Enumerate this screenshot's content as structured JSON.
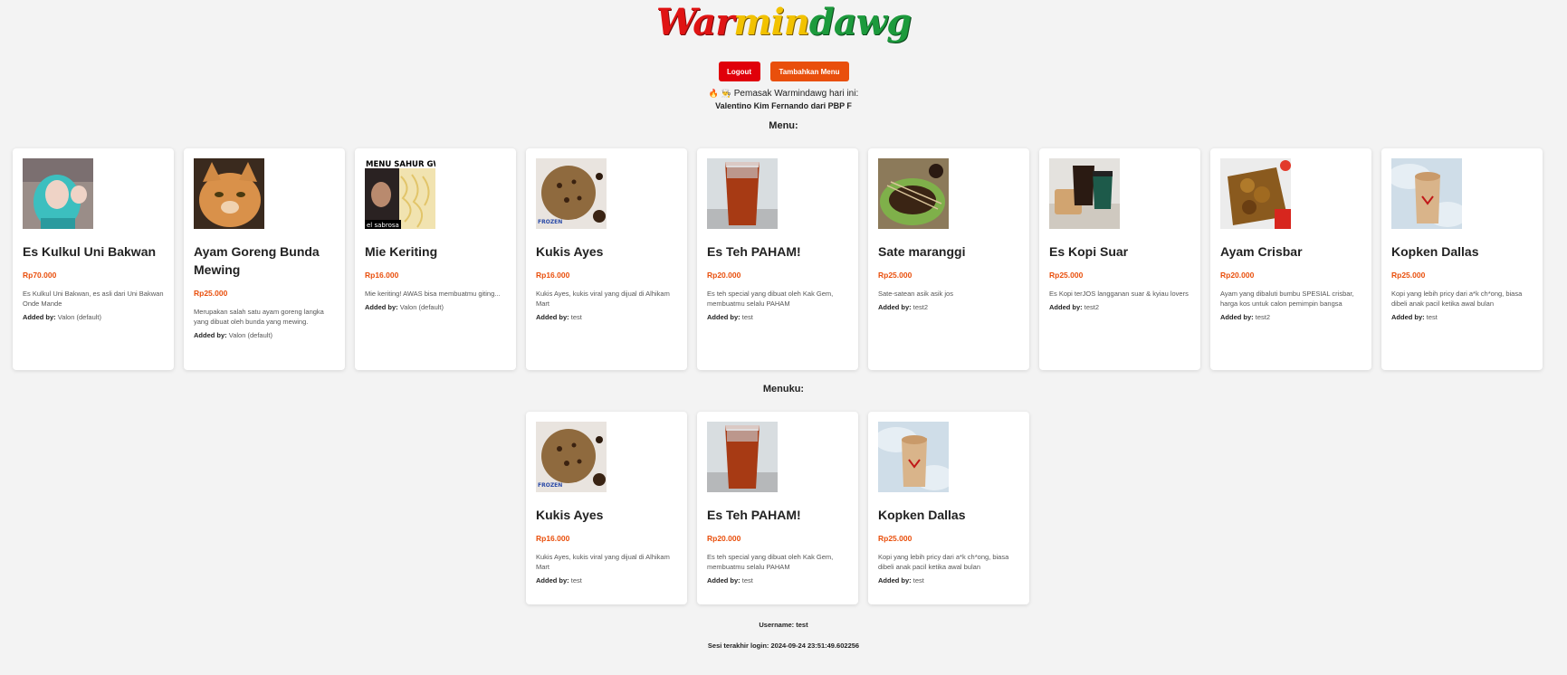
{
  "brand": {
    "part1": "War",
    "part2": "min",
    "part3": "dawg"
  },
  "buttons": {
    "logout": "Logout",
    "add_menu": "Tambahkan Menu"
  },
  "cook": {
    "prefix": "Pemasak Warmindawg hari ini:",
    "name": "Valentino Kim Fernando dari PBP F"
  },
  "sections": {
    "menu_title": "Menu:",
    "my_menu_title": "Menuku:"
  },
  "added_by_label": "Added by:",
  "menu": [
    {
      "name": "Es Kulkul Uni Bakwan",
      "price": "Rp70.000",
      "desc": "Es Kulkul Uni Bakwan, es asli dari Uni Bakwan Onde Mande",
      "added_by": "Valon (default)"
    },
    {
      "name": "Ayam Goreng Bunda Mewing",
      "price": "Rp25.000",
      "desc": "Merupakan salah satu ayam goreng langka yang dibuat oleh bunda yang mewing.",
      "added_by": "Valon (default)"
    },
    {
      "name": "Mie Keriting",
      "price": "Rp16.000",
      "desc": "Mie keriting! AWAS bisa membuatmu giting...",
      "added_by": "Valon (default)"
    },
    {
      "name": "Kukis Ayes",
      "price": "Rp16.000",
      "desc": "Kukis Ayes, kukis viral yang dijual di Alhikam Mart",
      "added_by": "test"
    },
    {
      "name": "Es Teh PAHAM!",
      "price": "Rp20.000",
      "desc": "Es teh special yang dibuat oleh Kak Gem, membuatmu selalu PAHAM",
      "added_by": "test"
    },
    {
      "name": "Sate maranggi",
      "price": "Rp25.000",
      "desc": "Sate-satean asik asik jos",
      "added_by": "test2"
    },
    {
      "name": "Es Kopi Suar",
      "price": "Rp25.000",
      "desc": "Es Kopi terJOS langganan suar & kyiau lovers",
      "added_by": "test2"
    },
    {
      "name": "Ayam Crisbar",
      "price": "Rp20.000",
      "desc": "Ayam yang dibaluti bumbu SPESIAL crisbar, harga kos untuk calon pemimpin bangsa",
      "added_by": "test2"
    },
    {
      "name": "Kopken Dallas",
      "price": "Rp25.000",
      "desc": "Kopi yang lebih pricy dari a*k ch*ong, biasa dibeli anak pacil ketika awal bulan",
      "added_by": "test"
    }
  ],
  "my_menu": [
    {
      "name": "Kukis Ayes",
      "price": "Rp16.000",
      "desc": "Kukis Ayes, kukis viral yang dijual di Alhikam Mart",
      "added_by": "test"
    },
    {
      "name": "Es Teh PAHAM!",
      "price": "Rp20.000",
      "desc": "Es teh special yang dibuat oleh Kak Gem, membuatmu selalu PAHAM",
      "added_by": "test"
    },
    {
      "name": "Kopken Dallas",
      "price": "Rp25.000",
      "desc": "Kopi yang lebih pricy dari a*k ch*ong, biasa dibeli anak pacil ketika awal bulan",
      "added_by": "test"
    }
  ],
  "image_texts": {
    "mie_banner": "MENU SAHUR GW",
    "mie_caption": "el sabrosa",
    "kukis_caption": "FROZEN"
  },
  "footer": {
    "username": "Username: test",
    "last_login": "Sesi terakhir login: 2024-09-24 23:51:49.602256"
  },
  "colors": {
    "accent": "#e94f0c",
    "logout": "#e0000a",
    "logo_red": "#e01414",
    "logo_yellow": "#f2c200",
    "logo_green": "#1c9a3c"
  }
}
